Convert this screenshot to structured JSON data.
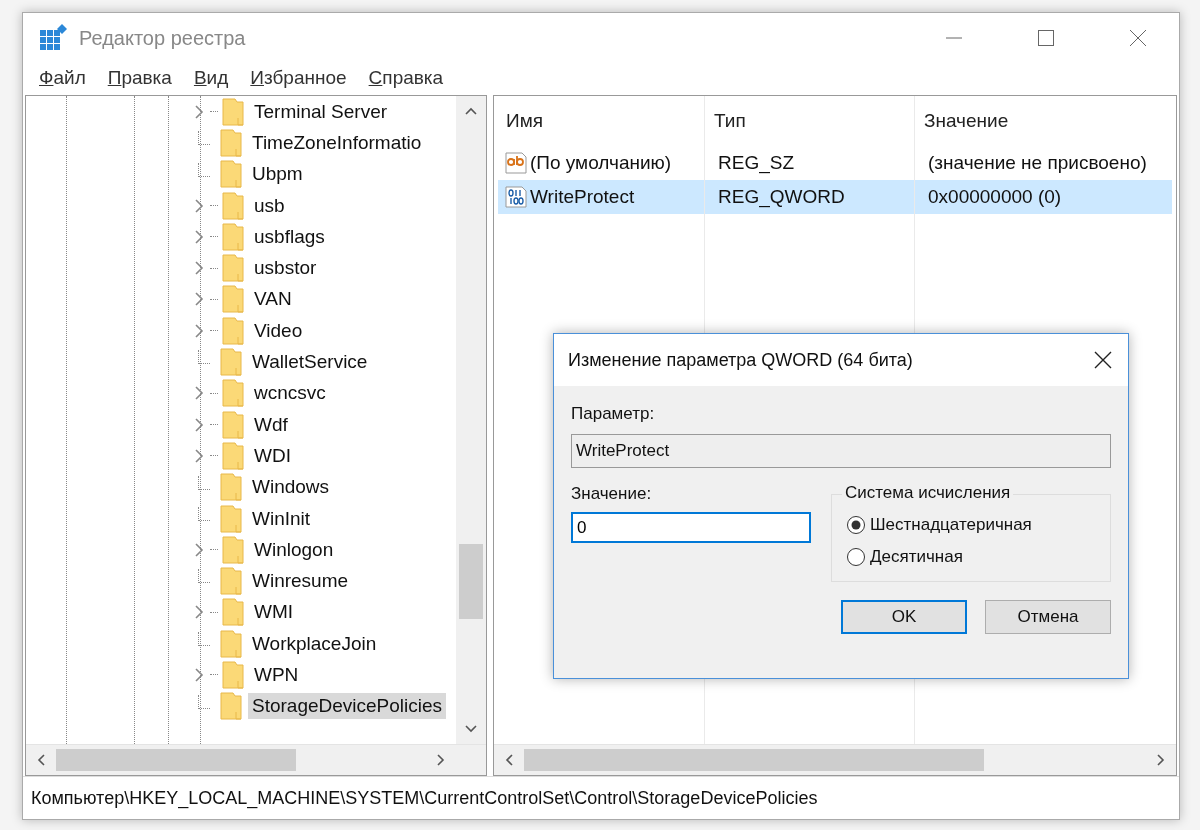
{
  "window": {
    "title": "Редактор реестра"
  },
  "menu": [
    "Файл",
    "Правка",
    "Вид",
    "Избранное",
    "Справка"
  ],
  "tree": {
    "items": [
      {
        "label": "Terminal Server",
        "expandable": true,
        "selected": false
      },
      {
        "label": "TimeZoneInformatio",
        "expandable": false,
        "selected": false
      },
      {
        "label": "Ubpm",
        "expandable": false,
        "selected": false
      },
      {
        "label": "usb",
        "expandable": true,
        "selected": false
      },
      {
        "label": "usbflags",
        "expandable": true,
        "selected": false
      },
      {
        "label": "usbstor",
        "expandable": true,
        "selected": false
      },
      {
        "label": "VAN",
        "expandable": true,
        "selected": false
      },
      {
        "label": "Video",
        "expandable": true,
        "selected": false
      },
      {
        "label": "WalletService",
        "expandable": false,
        "selected": false
      },
      {
        "label": "wcncsvc",
        "expandable": true,
        "selected": false
      },
      {
        "label": "Wdf",
        "expandable": true,
        "selected": false
      },
      {
        "label": "WDI",
        "expandable": true,
        "selected": false
      },
      {
        "label": "Windows",
        "expandable": false,
        "selected": false
      },
      {
        "label": "WinInit",
        "expandable": false,
        "selected": false
      },
      {
        "label": "Winlogon",
        "expandable": true,
        "selected": false
      },
      {
        "label": "Winresume",
        "expandable": false,
        "selected": false
      },
      {
        "label": "WMI",
        "expandable": true,
        "selected": false
      },
      {
        "label": "WorkplaceJoin",
        "expandable": false,
        "selected": false
      },
      {
        "label": "WPN",
        "expandable": true,
        "selected": false
      },
      {
        "label": "StorageDevicePolicies",
        "expandable": false,
        "selected": true
      }
    ]
  },
  "values": {
    "columns": [
      "Имя",
      "Тип",
      "Значение"
    ],
    "rows": [
      {
        "kind": "string",
        "name": "(По умолчанию)",
        "type": "REG_SZ",
        "data": "(значение не присвоено)",
        "selected": false
      },
      {
        "kind": "binary",
        "name": "WriteProtect",
        "type": "REG_QWORD",
        "data": "0x00000000 (0)",
        "selected": true
      }
    ]
  },
  "dialog": {
    "title": "Изменение параметра QWORD (64 бита)",
    "param_label": "Параметр:",
    "param_value": "WriteProtect",
    "value_label": "Значение:",
    "value": "0",
    "base_group": "Система исчисления",
    "bases": [
      {
        "label": "Шестнадцатеричная",
        "selected": true
      },
      {
        "label": "Десятичная",
        "selected": false
      }
    ],
    "buttons": [
      {
        "label": "OK",
        "default": true
      },
      {
        "label": "Отмена",
        "default": false
      }
    ]
  },
  "status_bar": "Компьютер\\HKEY_LOCAL_MACHINE\\SYSTEM\\CurrentControlSet\\Control\\StorageDevicePolicies"
}
